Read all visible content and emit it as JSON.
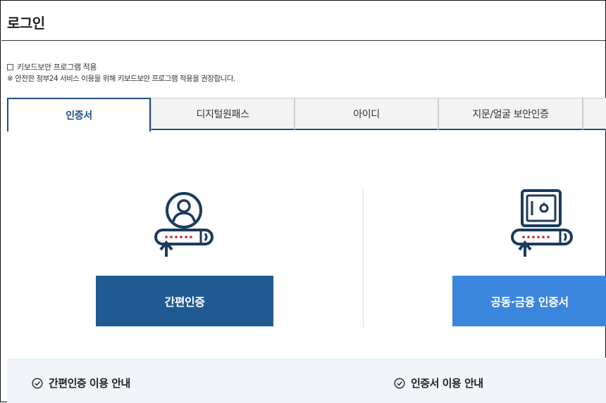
{
  "page": {
    "title": "로그인"
  },
  "keyboard_security": {
    "checkbox_label": "키보드보안 프로그램 적용",
    "note": "※ 안전한 정부24 서비스 이용을 위해 키보드보안 프로그램 적용을 권장합니다."
  },
  "tabs": [
    {
      "label": "인증서",
      "active": true
    },
    {
      "label": "디지털원패스",
      "active": false
    },
    {
      "label": "아이디",
      "active": false
    },
    {
      "label": "지문/얼굴 보안인증",
      "active": false
    }
  ],
  "auth_options": {
    "simple": {
      "button_label": "간편인증",
      "icon": "person-password-icon",
      "color": "#1f5a93"
    },
    "certificate": {
      "button_label": "공동·금융 인증서",
      "icon": "safe-password-icon",
      "color": "#3b86dd"
    }
  },
  "guide": {
    "simple_label": "간편인증 이용 안내",
    "certificate_label": "인증서 이용 안내",
    "icon": "check-circle-icon"
  },
  "colors": {
    "primary": "#1e4f7e",
    "accent_red": "#d0202e"
  }
}
